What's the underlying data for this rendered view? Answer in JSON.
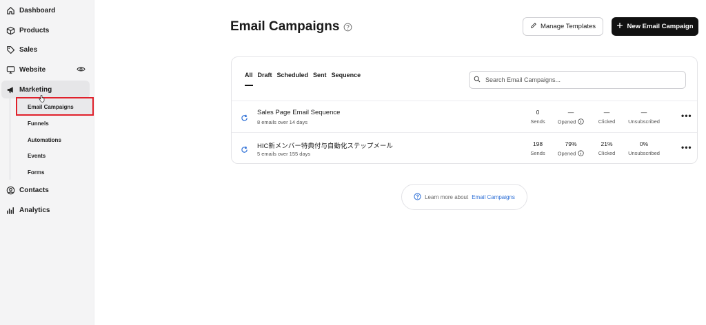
{
  "sidebar": {
    "items": [
      {
        "label": "Dashboard",
        "icon": "home-icon"
      },
      {
        "label": "Products",
        "icon": "box-icon"
      },
      {
        "label": "Sales",
        "icon": "tag-icon"
      },
      {
        "label": "Website",
        "icon": "monitor-icon"
      },
      {
        "label": "Marketing",
        "icon": "megaphone-icon"
      },
      {
        "label": "Contacts",
        "icon": "user-circle-icon"
      },
      {
        "label": "Analytics",
        "icon": "bar-chart-icon"
      }
    ],
    "marketing_sub": [
      "Email Campaigns",
      "Funnels",
      "Automations",
      "Events",
      "Forms"
    ]
  },
  "header": {
    "title": "Email Campaigns",
    "manage_templates": "Manage Templates",
    "new_campaign": "New Email Campaign"
  },
  "tabs": [
    "All",
    "Draft",
    "Scheduled",
    "Sent",
    "Sequence"
  ],
  "search": {
    "placeholder": "Search Email Campaigns..."
  },
  "stat_labels": [
    "Sends",
    "Opened",
    "Clicked",
    "Unsubscribed"
  ],
  "campaigns": [
    {
      "name": "Sales Page Email Sequence",
      "sub": "8 emails over 14 days",
      "sends": "0",
      "opened": "—",
      "clicked": "—",
      "unsubscribed": "—"
    },
    {
      "name": "HIC新メンバー特典付与自動化ステップメール",
      "sub": "5 emails over 155 days",
      "sends": "198",
      "opened": "79%",
      "clicked": "21%",
      "unsubscribed": "0%"
    }
  ],
  "learn_more": {
    "prefix": "Learn more about",
    "link": "Email Campaigns"
  },
  "colors": {
    "accent_dark": "#111111",
    "link": "#2d6fd6",
    "highlight": "#e0202a",
    "refresh": "#2d6fd6"
  }
}
